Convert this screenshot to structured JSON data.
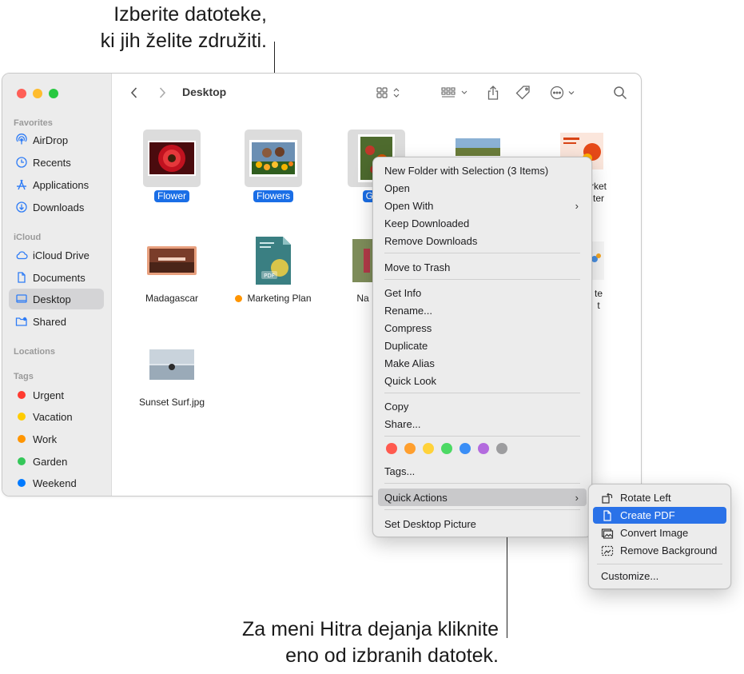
{
  "callouts": {
    "top_line1": "Izberite datoteke,",
    "top_line2": "ki jih želite združiti.",
    "bottom_line1": "Za meni Hitra dejanja kliknite",
    "bottom_line2": "eno od izbranih datotek."
  },
  "window": {
    "title": "Desktop"
  },
  "sidebar": {
    "favorites_label": "Favorites",
    "favorites": [
      {
        "label": "AirDrop",
        "icon": "airdrop-icon"
      },
      {
        "label": "Recents",
        "icon": "clock-icon"
      },
      {
        "label": "Applications",
        "icon": "applications-icon"
      },
      {
        "label": "Downloads",
        "icon": "download-icon"
      }
    ],
    "icloud_label": "iCloud",
    "icloud": [
      {
        "label": "iCloud Drive",
        "icon": "cloud-icon"
      },
      {
        "label": "Documents",
        "icon": "document-icon"
      },
      {
        "label": "Desktop",
        "icon": "desktop-icon",
        "selected": true
      },
      {
        "label": "Shared",
        "icon": "shared-folder-icon"
      }
    ],
    "locations_label": "Locations",
    "tags_label": "Tags",
    "tags": [
      {
        "label": "Urgent",
        "color": "#ff3b30"
      },
      {
        "label": "Vacation",
        "color": "#ffcc00"
      },
      {
        "label": "Work",
        "color": "#ff9500"
      },
      {
        "label": "Garden",
        "color": "#34c759"
      },
      {
        "label": "Weekend",
        "color": "#007aff"
      }
    ]
  },
  "files": {
    "flower": "Flower",
    "flowers": "Flowers",
    "garden": "Gard",
    "market_line1": "rket",
    "market_line2": "ter",
    "madagascar": "Madagascar",
    "marketing_plan": "Marketing Plan",
    "na": "Na",
    "right_partial_1": "te",
    "right_partial_2": "t",
    "sunset": "Sunset Surf.jpg",
    "marketing_tag_color": "#ff9500"
  },
  "context_menu": {
    "items": [
      "New Folder with Selection (3 Items)",
      "Open",
      "Open With",
      "Keep Downloaded",
      "Remove Downloads",
      "Move to Trash",
      "Get Info",
      "Rename...",
      "Compress",
      "Duplicate",
      "Make Alias",
      "Quick Look",
      "Copy",
      "Share...",
      "Tags...",
      "Quick Actions",
      "Set Desktop Picture"
    ],
    "tag_colors": [
      "#ff5a4f",
      "#ff9f2e",
      "#ffd23a",
      "#4cd964",
      "#3a8ef6",
      "#b36bde",
      "#9d9d9f"
    ],
    "submenu_chevron": "›"
  },
  "quick_actions": {
    "items": [
      "Rotate Left",
      "Create PDF",
      "Convert Image",
      "Remove Background"
    ],
    "customize": "Customize..."
  }
}
